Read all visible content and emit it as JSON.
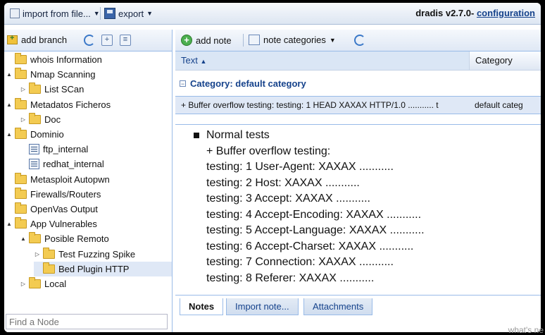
{
  "toolbar": {
    "import_label": "import from file...",
    "export_label": "export",
    "brand_text": "dradis v2.7.0-",
    "brand_link": "configuration"
  },
  "tree_toolbar": {
    "add_branch": "add branch"
  },
  "tree": [
    {
      "label": "whois Information",
      "depth": 0,
      "toggle": "",
      "icon": "folder"
    },
    {
      "label": "Nmap Scanning",
      "depth": 0,
      "toggle": "▲",
      "icon": "folder"
    },
    {
      "label": "List SCan",
      "depth": 1,
      "toggle": "▷",
      "icon": "folder"
    },
    {
      "label": "Metadatos Ficheros",
      "depth": 0,
      "toggle": "▲",
      "icon": "folder"
    },
    {
      "label": "Doc",
      "depth": 1,
      "toggle": "▷",
      "icon": "folder"
    },
    {
      "label": "Dominio",
      "depth": 0,
      "toggle": "▲",
      "icon": "folder"
    },
    {
      "label": "ftp_internal",
      "depth": 1,
      "toggle": "",
      "icon": "note"
    },
    {
      "label": "redhat_internal",
      "depth": 1,
      "toggle": "",
      "icon": "note"
    },
    {
      "label": "Metasploit Autopwn",
      "depth": 0,
      "toggle": "",
      "icon": "folder"
    },
    {
      "label": "Firewalls/Routers",
      "depth": 0,
      "toggle": "",
      "icon": "folder"
    },
    {
      "label": "OpenVas Output",
      "depth": 0,
      "toggle": "",
      "icon": "folder"
    },
    {
      "label": "App Vulnerables",
      "depth": 0,
      "toggle": "▲",
      "icon": "folder"
    },
    {
      "label": "Posible Remoto",
      "depth": 1,
      "toggle": "▲",
      "icon": "folder"
    },
    {
      "label": "Test Fuzzing Spike",
      "depth": 2,
      "toggle": "▷",
      "icon": "folder"
    },
    {
      "label": "Bed Plugin HTTP",
      "depth": 2,
      "toggle": "",
      "icon": "folder",
      "selected": true
    },
    {
      "label": "Local",
      "depth": 1,
      "toggle": "▷",
      "icon": "folder"
    }
  ],
  "find_node_placeholder": "Find a Node",
  "notes_toolbar": {
    "add_note": "add note",
    "note_categories": "note categories"
  },
  "grid": {
    "col_text": "Text",
    "col_category": "Category",
    "group_label": "Category: default category",
    "row_text": "+ Buffer overflow testing: testing: 1 HEAD XAXAX HTTP/1.0 ........... t",
    "row_category": "default categ"
  },
  "preview": {
    "bullet": "Normal tests",
    "lines": [
      "+ Buffer overflow testing:",
      "testing: 1 User-Agent: XAXAX ...........",
      "testing: 2 Host: XAXAX ...........",
      "testing: 3 Accept: XAXAX ...........",
      "testing: 4 Accept-Encoding: XAXAX ...........",
      "testing: 5 Accept-Language: XAXAX ...........",
      "testing: 6 Accept-Charset: XAXAX ...........",
      "testing: 7 Connection: XAXAX ...........",
      "testing: 8 Referer: XAXAX ..........."
    ]
  },
  "tabs": [
    "Notes",
    "Import note...",
    "Attachments"
  ],
  "corner_text": "what's ne"
}
